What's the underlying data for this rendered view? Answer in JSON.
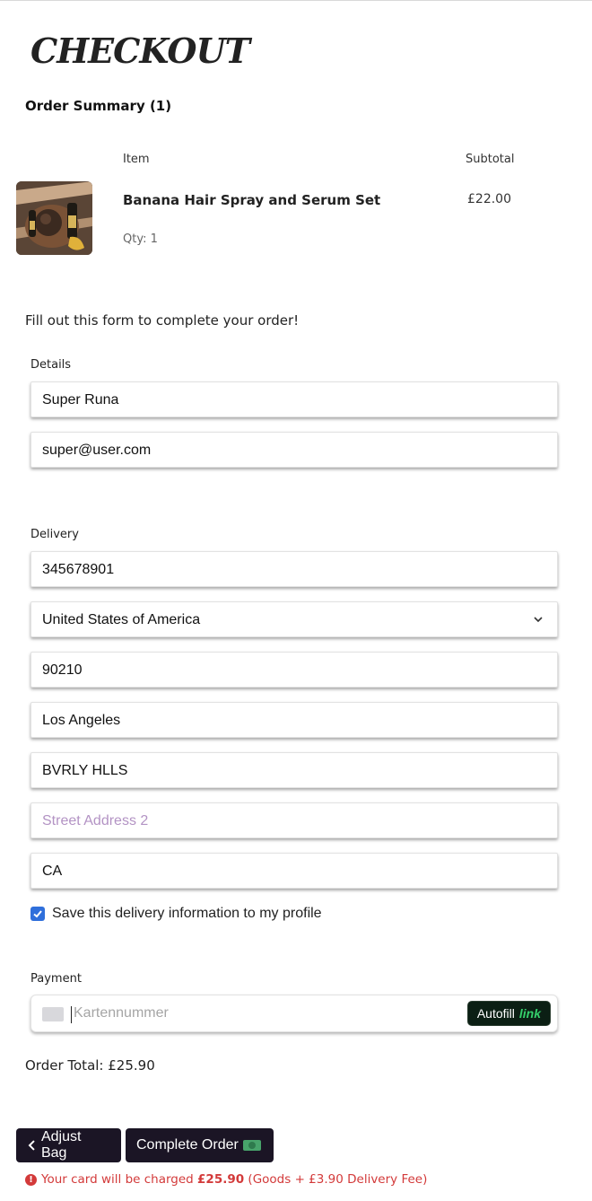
{
  "page": {
    "title": "CHECKOUT",
    "order_summary": "Order Summary (1)",
    "intro": "Fill out this form to complete your order!"
  },
  "table": {
    "col_item": "Item",
    "col_subtotal": "Subtotal"
  },
  "product": {
    "name": "Banana Hair Spray and Serum Set",
    "price": "£22.00",
    "qty": "Qty: 1",
    "image_icon": "product-photo"
  },
  "details": {
    "label": "Details",
    "name_value": "Super Runa",
    "email_value": "super@user.com"
  },
  "delivery": {
    "label": "Delivery",
    "phone_value": "345678901",
    "country_value": "United States of America",
    "postcode_value": "90210",
    "city_value": "Los Angeles",
    "street1_value": "BVRLY HLLS",
    "street2_placeholder": "Street Address 2",
    "county_value": "CA",
    "save_checked": true,
    "save_label": "Save this delivery information to my profile"
  },
  "payment": {
    "label": "Payment",
    "card_placeholder": "Kartennummer",
    "autofill_label": "Autofill",
    "autofill_link": "link"
  },
  "total": {
    "text": "Order Total: £25.90"
  },
  "buttons": {
    "adjust_label": "Adjust Bag",
    "complete_label": "Complete Order"
  },
  "warning": {
    "text_pre": "Your card will be charged ",
    "amount": "£25.90",
    "text_post": " (Goods + £3.90 Delivery Fee)"
  },
  "colors": {
    "button_bg": "#1b1525",
    "checkbox": "#2f6fdb",
    "warning": "#d33a3a",
    "autofill_link": "#35d06b"
  }
}
